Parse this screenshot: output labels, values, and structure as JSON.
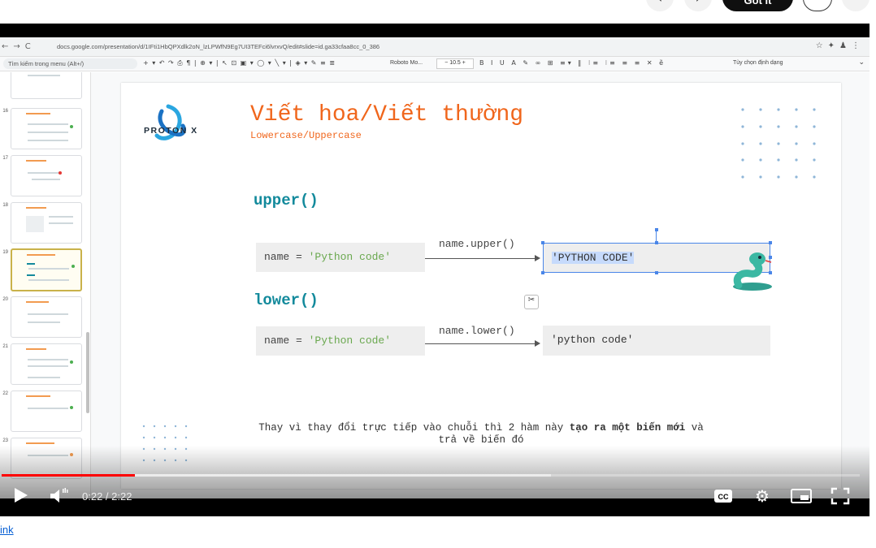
{
  "top_bar": {
    "prev_icon": "chevron-left-icon",
    "next_icon": "chevron-right-icon",
    "got_it_label": "Got it",
    "feedback_icon": "feedback-icon",
    "more_icon": "more-icon"
  },
  "browser": {
    "url": "docs.google.com/presentation/d/1IFti1HbQPXdlk2oN_lzLPWfN9Eg7UI3TEFci6lvrxvQ/edit#slide=id.ga33cfaa8cc_0_386",
    "menu_search_placeholder": "Tìm kiếm trong menu (Alt+/)",
    "font_name": "Roboto Mo...",
    "font_size": "10.5",
    "format_options": "Tùy chọn định dạng"
  },
  "slides_panel": {
    "thumbnails": [
      {
        "number": "16"
      },
      {
        "number": "17"
      },
      {
        "number": "18"
      },
      {
        "number": "19",
        "active": true
      },
      {
        "number": "20"
      },
      {
        "number": "21"
      },
      {
        "number": "22"
      },
      {
        "number": "23"
      }
    ]
  },
  "slide": {
    "brand": "PROTON X",
    "title": "Viết hoa/Viết thường",
    "subtitle": "Lowercase/Uppercase",
    "upper_heading": "upper()",
    "upper_code_prefix": "name = ",
    "upper_code_string": "'Python code'",
    "upper_call": "name.upper()",
    "upper_result": "'PYTHON CODE'",
    "lower_heading": "lower()",
    "lower_code_prefix": "name = ",
    "lower_code_string": "'Python code'",
    "lower_call": "name.lower()",
    "lower_result": "'python code'",
    "footnote_prefix": "Thay vì thay đổi trực tiếp vào chuỗi thì 2 hàm này ",
    "footnote_bold": "tạo ra một biến mới",
    "footnote_suffix": " và",
    "footnote_line2": "trả về biến đó"
  },
  "player": {
    "current_time": "0:22",
    "separator": " / ",
    "duration": "2:22",
    "played_fraction": 0.155,
    "buffered_fraction": 0.64,
    "icons": [
      "play-icon",
      "volume-icon",
      "captions-icon",
      "settings-icon",
      "miniplayer-icon",
      "fullscreen-icon"
    ]
  },
  "below": {
    "link_text": "ink"
  },
  "colors": {
    "title_orange": "#f0661c",
    "heading_teal": "#138a9c",
    "string_green": "#6aa84f",
    "progress_red": "#ff0000",
    "link_blue": "#065fd4"
  }
}
